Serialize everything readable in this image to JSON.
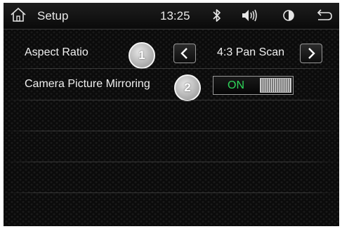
{
  "status_bar": {
    "title": "Setup",
    "time": "13:25",
    "icons": [
      "home-icon",
      "bluetooth-icon",
      "volume-icon",
      "brightness-icon",
      "back-icon"
    ]
  },
  "settings": {
    "aspect_ratio": {
      "label": "Aspect Ratio",
      "badge": "1",
      "value": "4:3 Pan Scan"
    },
    "camera_mirroring": {
      "label": "Camera Picture Mirroring",
      "badge": "2",
      "toggle_state": "ON"
    }
  },
  "colors": {
    "toggle_on_text": "#2fd65a",
    "background": "#0b0b0b"
  }
}
